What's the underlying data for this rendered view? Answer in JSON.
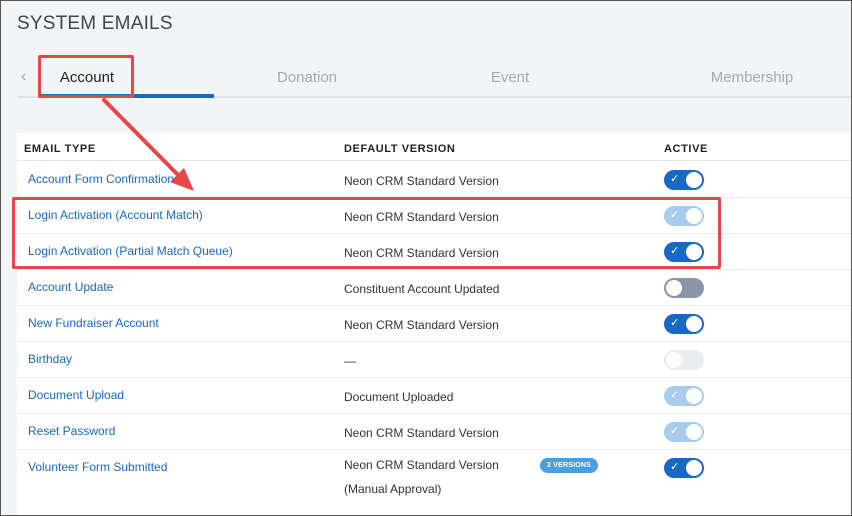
{
  "page": {
    "title": "SYSTEM EMAILS"
  },
  "tabs": {
    "prev_icon": "chevron-left-icon",
    "items": [
      {
        "label": "Account",
        "active": true
      },
      {
        "label": "Donation",
        "active": false
      },
      {
        "label": "Event",
        "active": false
      },
      {
        "label": "Membership",
        "active": false
      }
    ]
  },
  "table": {
    "headers": {
      "email_type": "EMAIL TYPE",
      "default_version": "DEFAULT VERSION",
      "active": "ACTIVE"
    },
    "rows": [
      {
        "email_type": "Account Form Confirmation",
        "default_version": "Neon CRM Standard Version",
        "active": "on"
      },
      {
        "email_type": "Login Activation (Account Match)",
        "default_version": "Neon CRM Standard Version",
        "active": "on-disabled"
      },
      {
        "email_type": "Login Activation (Partial Match Queue)",
        "default_version": "Neon CRM Standard Version",
        "active": "on"
      },
      {
        "email_type": "Account Update",
        "default_version": "Constituent Account Updated",
        "active": "off"
      },
      {
        "email_type": "New Fundraiser Account",
        "default_version": "Neon CRM Standard Version",
        "active": "on"
      },
      {
        "email_type": "Birthday",
        "default_version": "—",
        "active": "off-disabled"
      },
      {
        "email_type": "Document Upload",
        "default_version": "Document Uploaded",
        "active": "on-disabled"
      },
      {
        "email_type": "Reset Password",
        "default_version": "Neon CRM Standard Version",
        "active": "on-disabled"
      },
      {
        "email_type": "Volunteer Form Submitted",
        "default_version": "Neon CRM Standard Version",
        "default_version_line2": "(Manual Approval)",
        "badge": "2 VERSIONS",
        "active": "on"
      }
    ]
  },
  "colors": {
    "accent": "#1769c4",
    "annotation": "#e8474a",
    "link": "#1769c4"
  }
}
